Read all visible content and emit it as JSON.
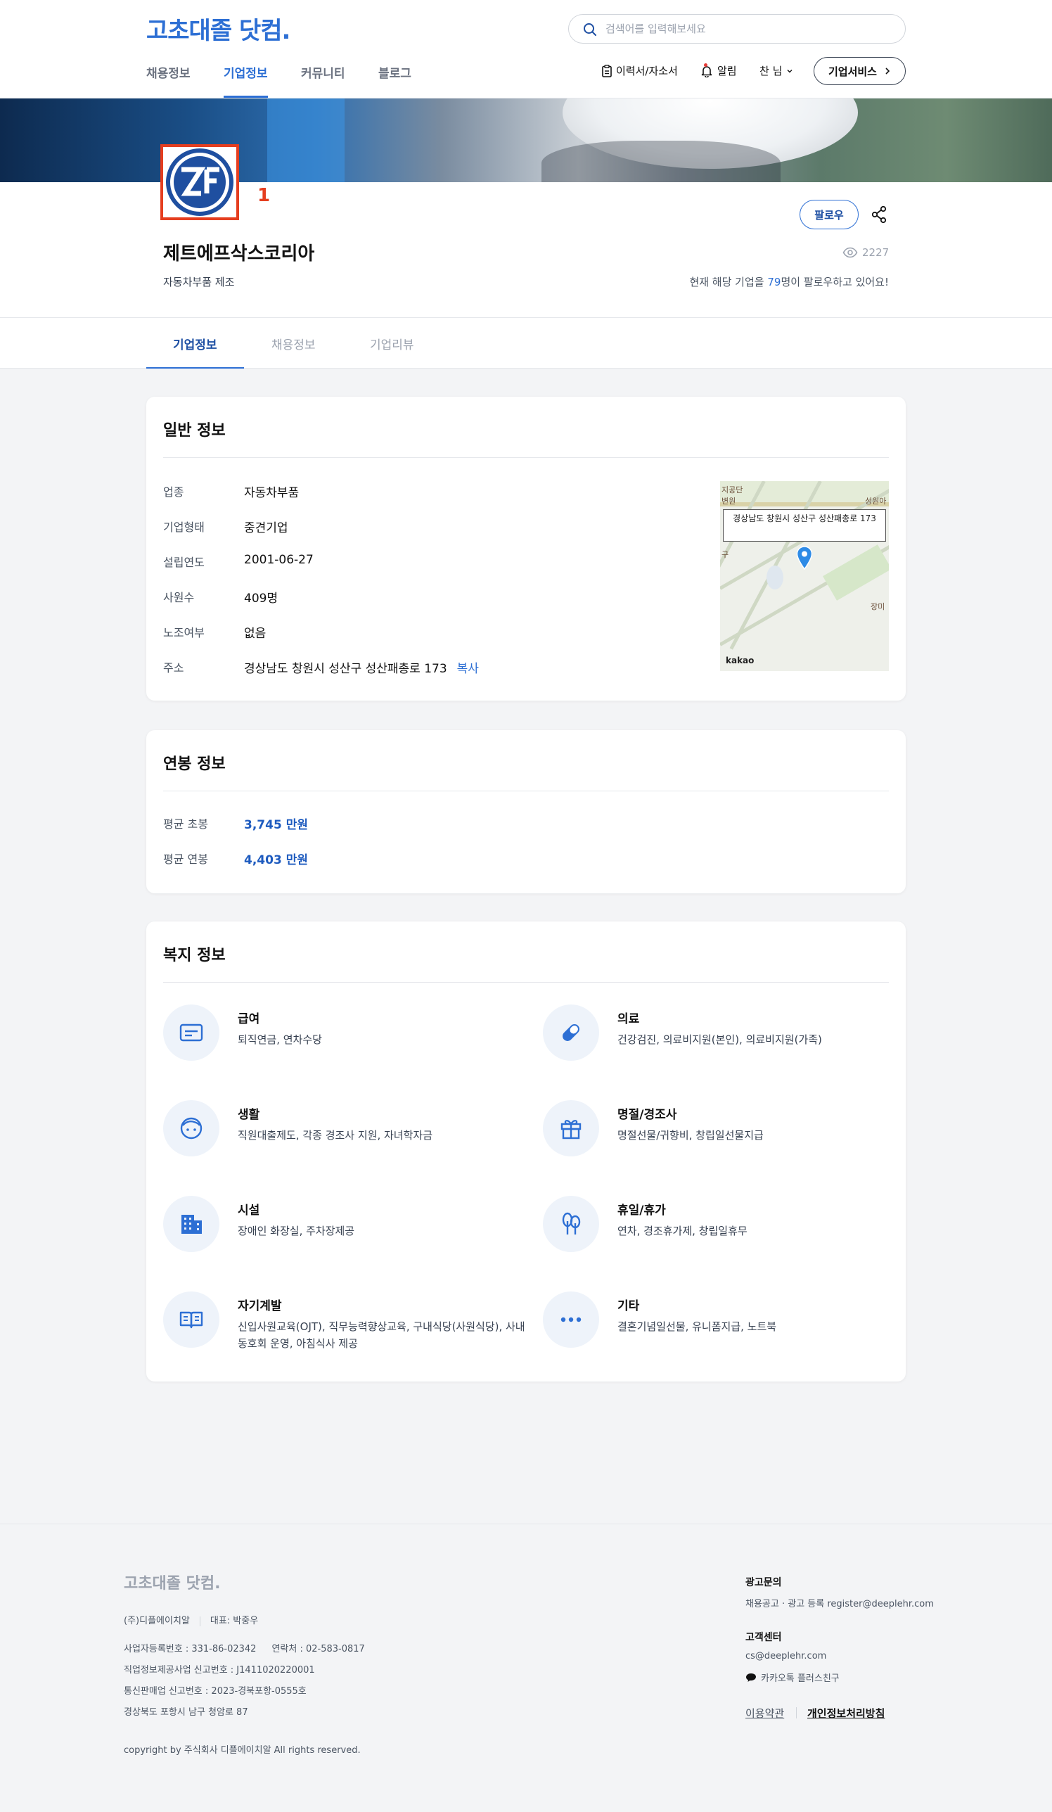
{
  "header": {
    "logo": "고초대졸 닷컴.",
    "search_placeholder": "검색어를 입력해보세요",
    "nav": [
      "채용정보",
      "기업정보",
      "커뮤니티",
      "블로그"
    ],
    "active_nav": "기업정보",
    "resume_label": "이력서/자소서",
    "alarm_label": "알림",
    "user_label": "찬 님",
    "biz_service_label": "기업서비스"
  },
  "profile": {
    "annotation_number": "1",
    "follow_label": "팔로우",
    "company_name": "제트에프삭스코리아",
    "sector": "자동차부품 제조",
    "view_count": "2227",
    "follow_prefix": "현재 해당 기업을 ",
    "follow_count": "79",
    "follow_suffix": "명이 팔로우하고 있어요!"
  },
  "tabs": [
    "기업정보",
    "채용정보",
    "기업리뷰"
  ],
  "general": {
    "title": "일반 정보",
    "rows": [
      {
        "label": "업종",
        "value": "자동차부품"
      },
      {
        "label": "기업형태",
        "value": "중견기업"
      },
      {
        "label": "설립연도",
        "value": "2001-06-27"
      },
      {
        "label": "사원수",
        "value": "409명"
      },
      {
        "label": "노조여부",
        "value": "없음"
      },
      {
        "label": "주소",
        "value": "경상남도 창원시 성산구 성산패총로 173"
      }
    ],
    "copy_label": "복사",
    "map_label": "경상남도 창원시 성산구 성산패총로 173",
    "map_brand": "kakao",
    "map_side_labels": [
      "지공단",
      "변원",
      "성원아",
      "구",
      "장미"
    ]
  },
  "salary": {
    "title": "연봉 정보",
    "rows": [
      {
        "label": "평균 초봉",
        "value": "3,745 만원"
      },
      {
        "label": "평균 연봉",
        "value": "4,403 만원"
      }
    ]
  },
  "welfare": {
    "title": "복지 정보",
    "items": [
      {
        "title": "급여",
        "desc": "퇴직연금, 연차수당",
        "icon": "card-icon"
      },
      {
        "title": "의료",
        "desc": "건강검진, 의료비지원(본인), 의료비지원(가족)",
        "icon": "pill-icon"
      },
      {
        "title": "생활",
        "desc": "직원대출제도, 각종 경조사 지원, 자녀학자금",
        "icon": "face-icon"
      },
      {
        "title": "명절/경조사",
        "desc": "명절선물/귀향비, 창립일선물지급",
        "icon": "gift-icon"
      },
      {
        "title": "시설",
        "desc": "장애인 화장실, 주차장제공",
        "icon": "building-icon"
      },
      {
        "title": "휴일/휴가",
        "desc": "연차, 경조휴가제, 창립일휴무",
        "icon": "tree-icon"
      },
      {
        "title": "자기계발",
        "desc": "신입사원교육(OJT), 직무능력향상교육, 구내식당(사원식당), 사내동호회 운영, 아침식사 제공",
        "icon": "book-icon"
      },
      {
        "title": "기타",
        "desc": "결혼기념일선물, 유니폼지급, 노트북",
        "icon": "more-icon"
      }
    ]
  },
  "footer": {
    "logo": "고초대졸 닷컴.",
    "company": "(주)디플에이치알",
    "ceo": "대표: 박중우",
    "biz_no": "사업자등록번호 : 331-86-02342",
    "contact": "연락처 : 02-583-0817",
    "job_report": "직업정보제공사업 신고번호 : J1411020220001",
    "ecommerce": "통신판매업 신고번호 : 2023-경북포항-0555호",
    "address": "경상북도 포항시 남구 청암로 87",
    "copyright": "copyright by 주식회사 디플에이치알 All rights reserved.",
    "ad_title": "광고문의",
    "ad_text": "채용공고 · 광고 등록 register@deeplehr.com",
    "cs_title": "고객센터",
    "cs_email": "cs@deeplehr.com",
    "kakao": "카카오톡 플러스친구",
    "terms": "이용약관",
    "privacy": "개인정보처리방침"
  },
  "colors": {
    "accent": "#2d6fd4",
    "marker": "#e53e1f"
  }
}
